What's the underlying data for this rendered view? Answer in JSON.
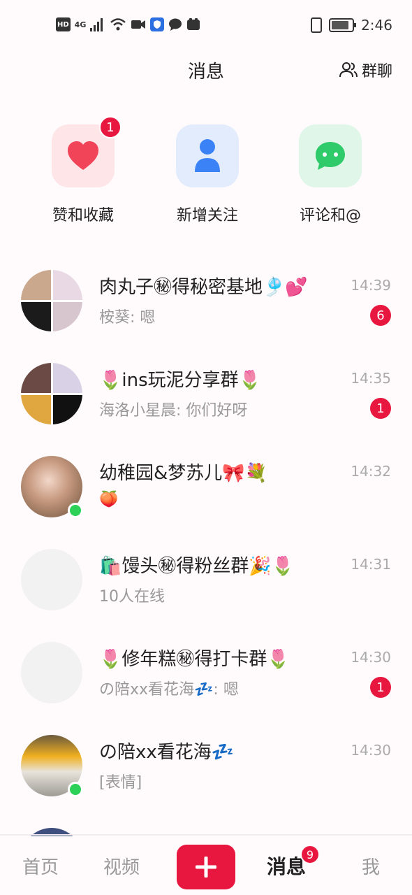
{
  "status_bar": {
    "chip_hd": "HD",
    "chip_net": "4G",
    "time": "2:46",
    "icons": [
      "hd-icon",
      "4g-icon",
      "signal-icon",
      "wifi-icon",
      "video-icon",
      "shield-icon",
      "chat-bubble-icon",
      "app-icon",
      "vibrate-icon",
      "battery-icon"
    ]
  },
  "header": {
    "title": "消息",
    "group_chat_label": "群聊",
    "group_chat_icon": "people-icon"
  },
  "quick_actions": [
    {
      "label": "赞和收藏",
      "icon": "heart-icon",
      "badge": "1",
      "bg": "#fde5e8",
      "fg": "#f24458"
    },
    {
      "label": "新增关注",
      "icon": "person-icon",
      "badge": "",
      "bg": "#e2ecfd",
      "fg": "#3a82f6"
    },
    {
      "label": "评论和@",
      "icon": "comment-icon",
      "badge": "",
      "bg": "#e0f6e8",
      "fg": "#2fcb6a"
    }
  ],
  "conversations": [
    {
      "title": "肉丸子㊙得秘密基地🎐💕",
      "subtitle": "桉葵: 嗯",
      "time": "14:39",
      "badge": "6",
      "online": false,
      "avatar": "group"
    },
    {
      "title": "🌷ins玩泥分享群🌷",
      "subtitle": "海洛小星晨: 你们好呀",
      "time": "14:35",
      "badge": "1",
      "online": false,
      "avatar": "group"
    },
    {
      "title": "幼稚园&梦苏儿🎀💐",
      "subtitle": "🍑",
      "time": "14:32",
      "badge": "",
      "online": true,
      "avatar": "photo"
    },
    {
      "title": "🛍️馒头㊙得粉丝群🎉🌷",
      "subtitle": "10人在线",
      "time": "14:31",
      "badge": "",
      "online": false,
      "avatar": "blank"
    },
    {
      "title": "🌷修年糕㊙得打卡群🌷",
      "subtitle": "の陪xx看花海💤: 嗯",
      "time": "14:30",
      "badge": "1",
      "online": false,
      "avatar": "blank"
    },
    {
      "title": "の陪xx看花海💤",
      "subtitle": "[表情]",
      "time": "14:30",
      "badge": "",
      "online": true,
      "avatar": "photo"
    }
  ],
  "bottom_nav": {
    "home": "首页",
    "video": "视频",
    "messages": "消息",
    "messages_badge": "9",
    "me": "我",
    "plus_icon": "plus-icon"
  },
  "colors": {
    "accent": "#e8173f",
    "background": "#fffbfc",
    "online": "#2ed158"
  }
}
